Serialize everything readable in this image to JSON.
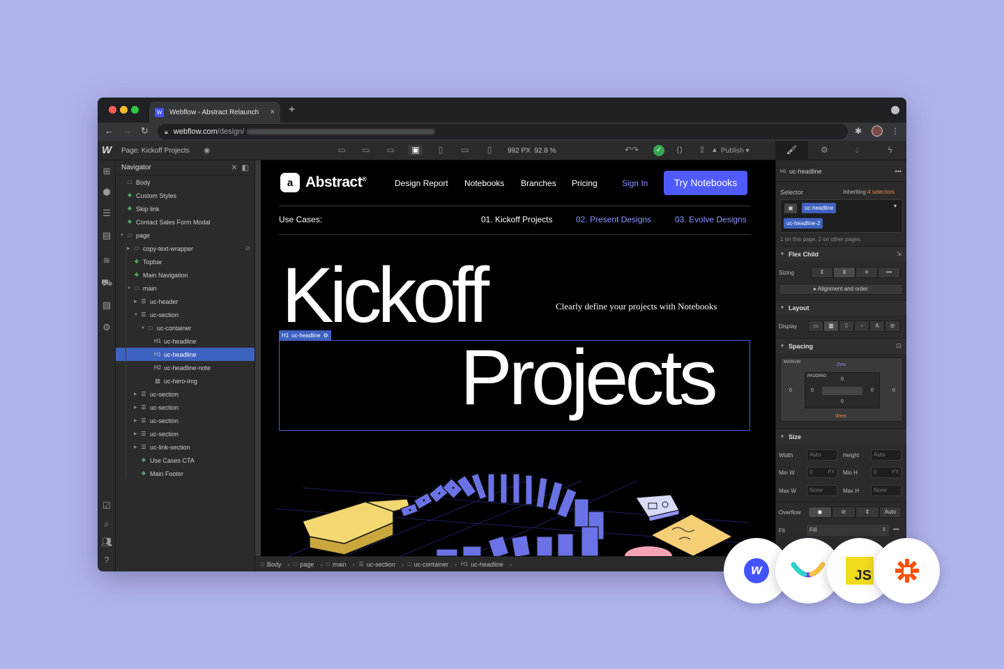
{
  "browser": {
    "tab_title": "Webflow - Abstract Relaunch",
    "tab_close": "×",
    "new_tab": "+",
    "url_host": "webflow.com",
    "url_path": "/design/"
  },
  "designer": {
    "page_label": "Page: Kickoff Projects",
    "breakpoint_px": "992 PX",
    "zoom": "92.8 %",
    "publish": "Publish",
    "style_tabs": [
      "brush-icon",
      "gear-icon",
      "drops-icon",
      "bolt-icon"
    ]
  },
  "navigator": {
    "title": "Navigator",
    "nodes": [
      {
        "label": "Body",
        "icon": "box",
        "depth": 0
      },
      {
        "label": "Custom Styles",
        "icon": "component",
        "depth": 0
      },
      {
        "label": "Skip link",
        "icon": "component",
        "depth": 0
      },
      {
        "label": "Contact Sales Form Modal",
        "icon": "component",
        "depth": 0
      },
      {
        "label": "page",
        "icon": "box",
        "depth": 0,
        "open": true
      },
      {
        "label": "copy-text-wrapper",
        "icon": "box",
        "depth": 1,
        "closed": true,
        "hidden": true
      },
      {
        "label": "Topbar",
        "icon": "component",
        "depth": 1
      },
      {
        "label": "Main Navigation",
        "icon": "component",
        "depth": 1
      },
      {
        "label": "main",
        "icon": "box",
        "depth": 1,
        "open": true
      },
      {
        "label": "uc-header",
        "icon": "section",
        "depth": 2,
        "closed": true
      },
      {
        "label": "uc-section",
        "icon": "section",
        "depth": 2,
        "open": true
      },
      {
        "label": "uc-container",
        "icon": "box",
        "depth": 3,
        "open": true
      },
      {
        "label": "uc-headline",
        "icon": "H1",
        "depth": 4
      },
      {
        "label": "uc-headline",
        "icon": "H1",
        "depth": 4,
        "selected": true
      },
      {
        "label": "uc-headline-note",
        "icon": "H2",
        "depth": 4
      },
      {
        "label": "uc-hero-img",
        "icon": "image",
        "depth": 4
      },
      {
        "label": "uc-section",
        "icon": "section",
        "depth": 2,
        "closed": true
      },
      {
        "label": "uc-section",
        "icon": "section",
        "depth": 2,
        "closed": true
      },
      {
        "label": "uc-section",
        "icon": "section",
        "depth": 2,
        "closed": true
      },
      {
        "label": "uc-section",
        "icon": "section",
        "depth": 2,
        "closed": true
      },
      {
        "label": "uc-link-section",
        "icon": "section",
        "depth": 2,
        "closed": true
      },
      {
        "label": "Use Cases CTA",
        "icon": "component",
        "depth": 2
      },
      {
        "label": "Main Footer",
        "icon": "component",
        "depth": 2
      }
    ]
  },
  "site": {
    "brand": "Abstract",
    "brand_mark": "®",
    "logo_glyph": "a",
    "nav": [
      "Design Report",
      "Notebooks",
      "Branches",
      "Pricing"
    ],
    "sign_in": "Sign In",
    "cta": "Try Notebooks",
    "use_cases_label": "Use Cases:",
    "use_cases": [
      "01. Kickoff Projects",
      "02. Present Designs",
      "03. Evolve Designs"
    ],
    "headline_1": "Kickoff",
    "headline_2": "Projects",
    "tagline": "Clearly define your projects with Notebooks",
    "selection_badge": "uc-headline",
    "selection_tag": "H1",
    "colors": {
      "accent": "#4f5bff",
      "link": "#8f96ff",
      "selection": "#3e62c0"
    }
  },
  "breadcrumb": [
    {
      "label": "Body",
      "icon": "□"
    },
    {
      "label": "page",
      "icon": "□"
    },
    {
      "label": "main",
      "icon": "□"
    },
    {
      "label": "uc-section",
      "icon": "☰"
    },
    {
      "label": "uc-container",
      "icon": "□"
    },
    {
      "label": "uc-headline",
      "icon": "H1"
    }
  ],
  "style_panel": {
    "element_tag": "H1",
    "element_name": "uc-headline",
    "more": "•••",
    "selector_label": "Selector",
    "inheriting": "Inheriting",
    "inheriting_count": "4 selectors",
    "classes": [
      "uc-headline",
      "uc-headline-2"
    ],
    "usage_note": "1 on this page, 2 on other pages.",
    "flex_child": "Flex Child",
    "sizing_label": "Sizing",
    "alignment_order": "Alignment and order",
    "layout": "Layout",
    "display_label": "Display",
    "spacing": "Spacing",
    "margin_cap": "MARGIN",
    "padding_cap": "PADDING",
    "margin_top": "-2vw",
    "margin_left": "0",
    "margin_right": "0",
    "margin_bottom": "0rem",
    "padding_top": "0",
    "padding_left": "0",
    "padding_right": "0",
    "padding_bottom": "0",
    "size": "Size",
    "width_label": "Width",
    "width_value": "Auto",
    "height_label": "Height",
    "height_value": "Auto",
    "minw_label": "Min W",
    "minw_value": "0",
    "minh_label": "Min H",
    "minh_value": "0",
    "maxw_label": "Max W",
    "maxw_value": "None",
    "maxh_label": "Max H",
    "maxh_value": "None",
    "unit_px": "PX",
    "unit_dash": "-",
    "overflow_label": "Overflow",
    "overflow_auto": "Auto",
    "fit_label": "Fit",
    "fit_value": "Fill"
  },
  "integrations": [
    "webflow-logo",
    "contentsquare-logo",
    "javascript-logo",
    "zapier-logo"
  ],
  "integration_text": {
    "webflow": "w",
    "js": "JS"
  }
}
